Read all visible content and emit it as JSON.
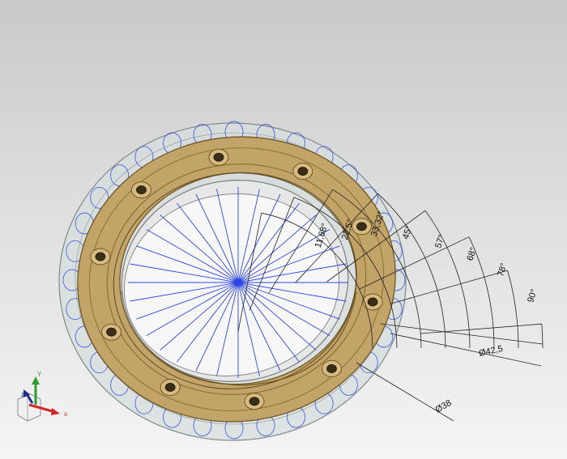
{
  "colors": {
    "background_top": "#c9c9c9",
    "flange_fill": "#c2a468",
    "flange_edge": "#6f5626",
    "housing_fill": "#d5dcdc",
    "construction_lines": "#2c46e6",
    "dimension_lines": "#222222",
    "axis_x": "#d42424",
    "axis_y": "#2f9b2f",
    "axis_z": "#1c2f8f"
  },
  "angle_dimensions": [
    {
      "label": "90°",
      "value": 90
    },
    {
      "label": "78°",
      "value": 78
    },
    {
      "label": "68°",
      "value": 68
    },
    {
      "label": "57°",
      "value": 57
    },
    {
      "label": "45°",
      "value": 45
    },
    {
      "label": "33,32°",
      "value": 33.32
    },
    {
      "label": "22,5°",
      "value": 22.5
    },
    {
      "label": "11,68°",
      "value": 11.68
    }
  ],
  "diameter_dimensions": [
    {
      "label": "Ø42,5",
      "value": 42.5
    },
    {
      "label": "Ø38",
      "value": 38
    }
  ],
  "flange": {
    "bolt_hole_count": 10
  },
  "pattern": {
    "spoke_count": 32,
    "rim_circle_count": 32
  },
  "triad": {
    "x_label": "x",
    "y_label": "Y",
    "z_label": "z",
    "x_icon": "axis-x-arrow-icon",
    "y_icon": "axis-y-arrow-icon",
    "z_icon": "axis-z-arrow-icon"
  }
}
